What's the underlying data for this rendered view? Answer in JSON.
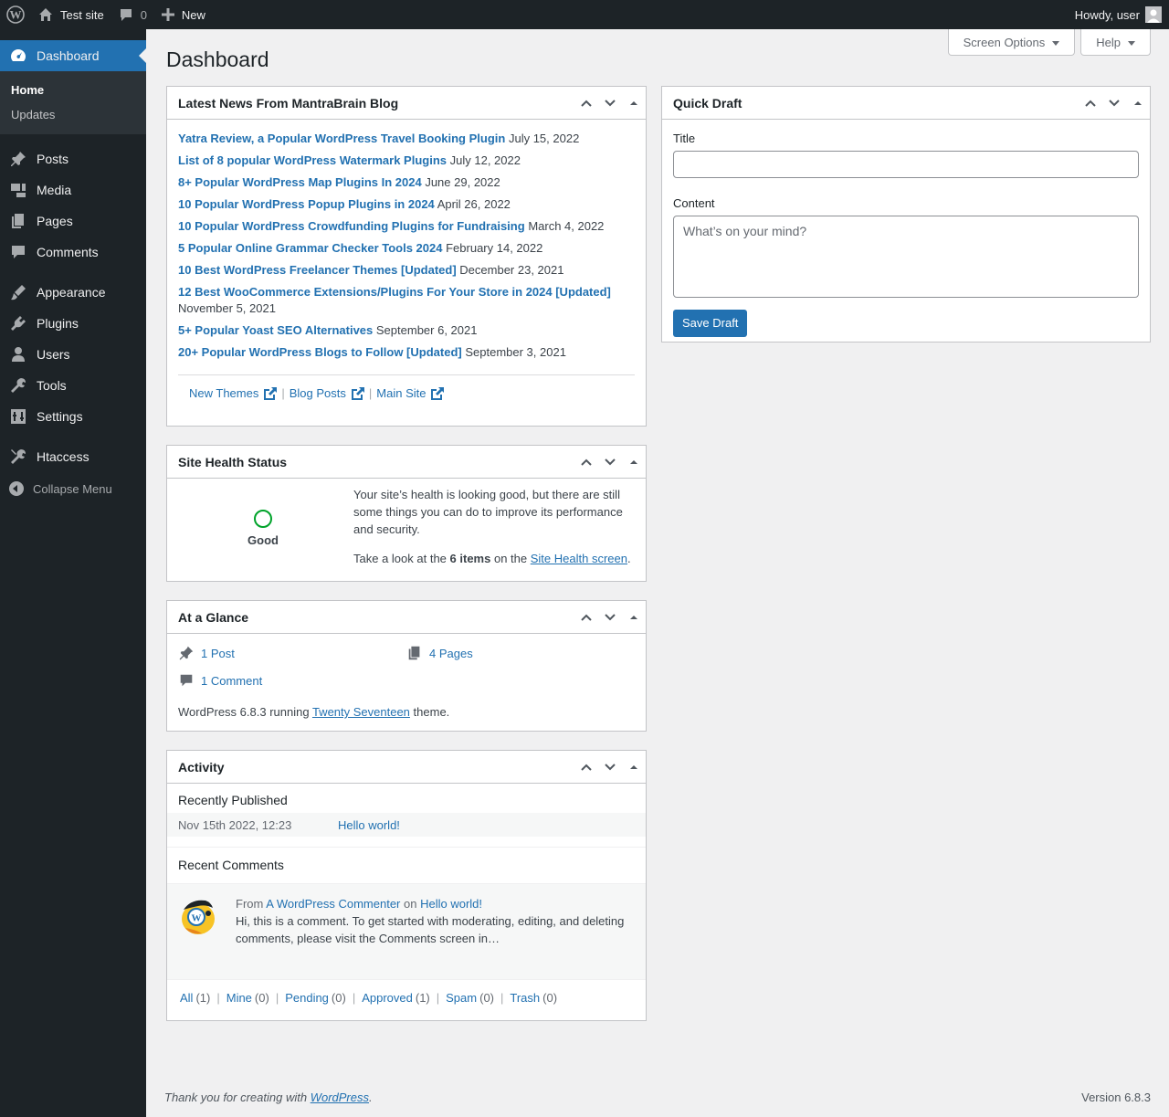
{
  "adminbar": {
    "site_name": "Test site",
    "comments_count": "0",
    "new_label": "New",
    "howdy": "Howdy, user"
  },
  "sidebar": {
    "dashboard": "Dashboard",
    "submenu": [
      "Home",
      "Updates"
    ],
    "items": [
      "Posts",
      "Media",
      "Pages",
      "Comments",
      "Appearance",
      "Plugins",
      "Users",
      "Tools",
      "Settings",
      "Htaccess"
    ],
    "collapse": "Collapse Menu"
  },
  "screen": {
    "options": "Screen Options",
    "help": "Help"
  },
  "page_title": "Dashboard",
  "news": {
    "title": "Latest News From MantraBrain Blog",
    "items": [
      {
        "title": "Yatra Review, a Popular WordPress Travel Booking Plugin",
        "date": "July 15, 2022"
      },
      {
        "title": "List of 8 popular WordPress Watermark Plugins",
        "date": "July 12, 2022"
      },
      {
        "title": "8+ Popular WordPress Map Plugins In 2024",
        "date": "June 29, 2022"
      },
      {
        "title": "10 Popular WordPress Popup Plugins in 2024",
        "date": "April 26, 2022"
      },
      {
        "title": "10 Popular WordPress Crowdfunding Plugins for Fundraising",
        "date": "March 4, 2022"
      },
      {
        "title": "5 Popular Online Grammar Checker Tools 2024",
        "date": "February 14, 2022"
      },
      {
        "title": "10 Best WordPress Freelancer Themes [Updated]",
        "date": "December 23, 2021"
      },
      {
        "title": "12 Best WooCommerce Extensions/Plugins For Your Store in 2024 [Updated]",
        "date": "November 5, 2021"
      },
      {
        "title": "5+ Popular Yoast SEO Alternatives",
        "date": "September 6, 2021"
      },
      {
        "title": "20+ Popular WordPress Blogs to Follow [Updated]",
        "date": "September 3, 2021"
      }
    ],
    "links": [
      "New Themes",
      "Blog Posts",
      "Main Site"
    ]
  },
  "health": {
    "title": "Site Health Status",
    "status": "Good",
    "message": "Your site’s health is looking good, but there are still some things you can do to improve its performance and security.",
    "take_pre": "Take a look at the",
    "items": "6 items",
    "take_mid": "on the",
    "link": "Site Health screen",
    "take_post": "."
  },
  "glance": {
    "title": "At a Glance",
    "posts": "1 Post",
    "pages": "4 Pages",
    "comments": "1 Comment",
    "version_pre": "WordPress 6.8.3 running",
    "theme": "Twenty Seventeen",
    "version_post": "theme."
  },
  "activity": {
    "title": "Activity",
    "recently_published": "Recently Published",
    "pub_date": "Nov 15th 2022, 12:23",
    "pub_title": "Hello world!",
    "recent_comments": "Recent Comments",
    "from": "From",
    "commenter": "A WordPress Commenter",
    "on": "on",
    "post": "Hello world!",
    "excerpt": "Hi, this is a comment. To get started with moderating, editing, and deleting comments, please visit the Comments screen in…",
    "filters": [
      {
        "label": "All",
        "count": "(1)"
      },
      {
        "label": "Mine",
        "count": "(0)"
      },
      {
        "label": "Pending",
        "count": "(0)"
      },
      {
        "label": "Approved",
        "count": "(1)"
      },
      {
        "label": "Spam",
        "count": "(0)"
      },
      {
        "label": "Trash",
        "count": "(0)"
      }
    ]
  },
  "quickdraft": {
    "title": "Quick Draft",
    "title_label": "Title",
    "content_label": "Content",
    "content_placeholder": "What’s on your mind?",
    "save": "Save Draft"
  },
  "footer": {
    "thanks_pre": "Thank you for creating with",
    "wp": "WordPress",
    "thanks_post": ".",
    "version": "Version 6.8.3"
  }
}
